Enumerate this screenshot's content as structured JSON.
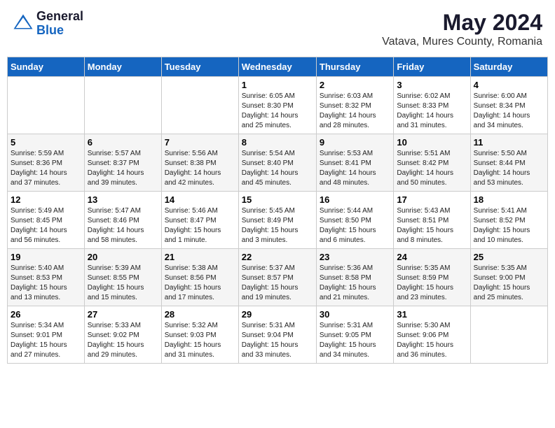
{
  "header": {
    "logo_general": "General",
    "logo_blue": "Blue",
    "month_year": "May 2024",
    "location": "Vatava, Mures County, Romania"
  },
  "weekdays": [
    "Sunday",
    "Monday",
    "Tuesday",
    "Wednesday",
    "Thursday",
    "Friday",
    "Saturday"
  ],
  "weeks": [
    [
      {
        "day": "",
        "info": ""
      },
      {
        "day": "",
        "info": ""
      },
      {
        "day": "",
        "info": ""
      },
      {
        "day": "1",
        "info": "Sunrise: 6:05 AM\nSunset: 8:30 PM\nDaylight: 14 hours\nand 25 minutes."
      },
      {
        "day": "2",
        "info": "Sunrise: 6:03 AM\nSunset: 8:32 PM\nDaylight: 14 hours\nand 28 minutes."
      },
      {
        "day": "3",
        "info": "Sunrise: 6:02 AM\nSunset: 8:33 PM\nDaylight: 14 hours\nand 31 minutes."
      },
      {
        "day": "4",
        "info": "Sunrise: 6:00 AM\nSunset: 8:34 PM\nDaylight: 14 hours\nand 34 minutes."
      }
    ],
    [
      {
        "day": "5",
        "info": "Sunrise: 5:59 AM\nSunset: 8:36 PM\nDaylight: 14 hours\nand 37 minutes."
      },
      {
        "day": "6",
        "info": "Sunrise: 5:57 AM\nSunset: 8:37 PM\nDaylight: 14 hours\nand 39 minutes."
      },
      {
        "day": "7",
        "info": "Sunrise: 5:56 AM\nSunset: 8:38 PM\nDaylight: 14 hours\nand 42 minutes."
      },
      {
        "day": "8",
        "info": "Sunrise: 5:54 AM\nSunset: 8:40 PM\nDaylight: 14 hours\nand 45 minutes."
      },
      {
        "day": "9",
        "info": "Sunrise: 5:53 AM\nSunset: 8:41 PM\nDaylight: 14 hours\nand 48 minutes."
      },
      {
        "day": "10",
        "info": "Sunrise: 5:51 AM\nSunset: 8:42 PM\nDaylight: 14 hours\nand 50 minutes."
      },
      {
        "day": "11",
        "info": "Sunrise: 5:50 AM\nSunset: 8:44 PM\nDaylight: 14 hours\nand 53 minutes."
      }
    ],
    [
      {
        "day": "12",
        "info": "Sunrise: 5:49 AM\nSunset: 8:45 PM\nDaylight: 14 hours\nand 56 minutes."
      },
      {
        "day": "13",
        "info": "Sunrise: 5:47 AM\nSunset: 8:46 PM\nDaylight: 14 hours\nand 58 minutes."
      },
      {
        "day": "14",
        "info": "Sunrise: 5:46 AM\nSunset: 8:47 PM\nDaylight: 15 hours\nand 1 minute."
      },
      {
        "day": "15",
        "info": "Sunrise: 5:45 AM\nSunset: 8:49 PM\nDaylight: 15 hours\nand 3 minutes."
      },
      {
        "day": "16",
        "info": "Sunrise: 5:44 AM\nSunset: 8:50 PM\nDaylight: 15 hours\nand 6 minutes."
      },
      {
        "day": "17",
        "info": "Sunrise: 5:43 AM\nSunset: 8:51 PM\nDaylight: 15 hours\nand 8 minutes."
      },
      {
        "day": "18",
        "info": "Sunrise: 5:41 AM\nSunset: 8:52 PM\nDaylight: 15 hours\nand 10 minutes."
      }
    ],
    [
      {
        "day": "19",
        "info": "Sunrise: 5:40 AM\nSunset: 8:53 PM\nDaylight: 15 hours\nand 13 minutes."
      },
      {
        "day": "20",
        "info": "Sunrise: 5:39 AM\nSunset: 8:55 PM\nDaylight: 15 hours\nand 15 minutes."
      },
      {
        "day": "21",
        "info": "Sunrise: 5:38 AM\nSunset: 8:56 PM\nDaylight: 15 hours\nand 17 minutes."
      },
      {
        "day": "22",
        "info": "Sunrise: 5:37 AM\nSunset: 8:57 PM\nDaylight: 15 hours\nand 19 minutes."
      },
      {
        "day": "23",
        "info": "Sunrise: 5:36 AM\nSunset: 8:58 PM\nDaylight: 15 hours\nand 21 minutes."
      },
      {
        "day": "24",
        "info": "Sunrise: 5:35 AM\nSunset: 8:59 PM\nDaylight: 15 hours\nand 23 minutes."
      },
      {
        "day": "25",
        "info": "Sunrise: 5:35 AM\nSunset: 9:00 PM\nDaylight: 15 hours\nand 25 minutes."
      }
    ],
    [
      {
        "day": "26",
        "info": "Sunrise: 5:34 AM\nSunset: 9:01 PM\nDaylight: 15 hours\nand 27 minutes."
      },
      {
        "day": "27",
        "info": "Sunrise: 5:33 AM\nSunset: 9:02 PM\nDaylight: 15 hours\nand 29 minutes."
      },
      {
        "day": "28",
        "info": "Sunrise: 5:32 AM\nSunset: 9:03 PM\nDaylight: 15 hours\nand 31 minutes."
      },
      {
        "day": "29",
        "info": "Sunrise: 5:31 AM\nSunset: 9:04 PM\nDaylight: 15 hours\nand 33 minutes."
      },
      {
        "day": "30",
        "info": "Sunrise: 5:31 AM\nSunset: 9:05 PM\nDaylight: 15 hours\nand 34 minutes."
      },
      {
        "day": "31",
        "info": "Sunrise: 5:30 AM\nSunset: 9:06 PM\nDaylight: 15 hours\nand 36 minutes."
      },
      {
        "day": "",
        "info": ""
      }
    ]
  ]
}
